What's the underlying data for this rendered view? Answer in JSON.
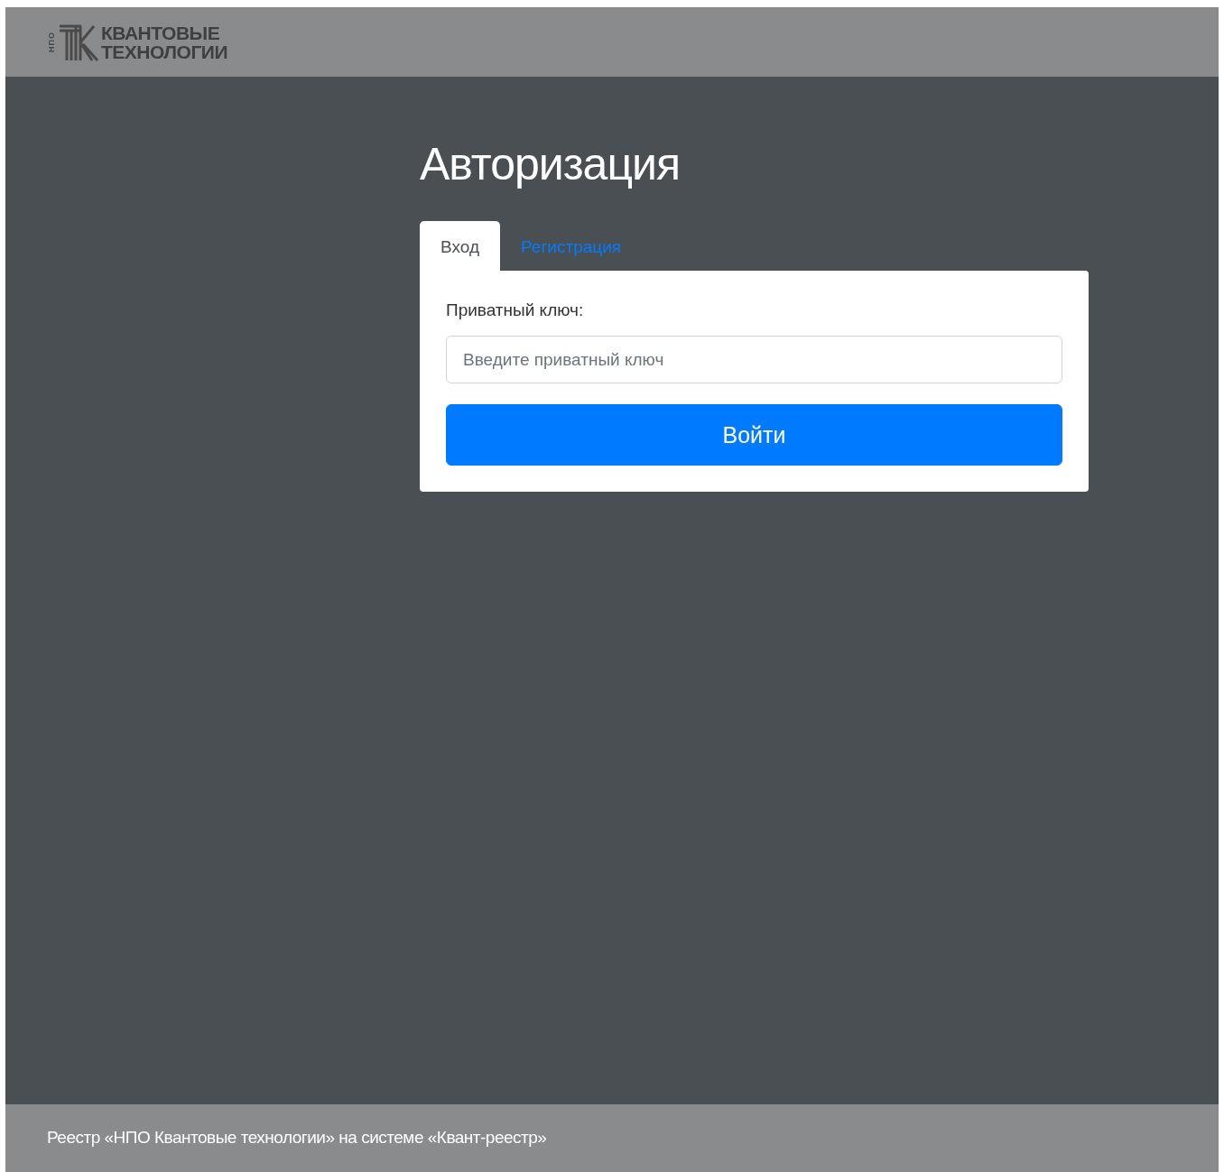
{
  "header": {
    "logo": {
      "side_text": "НПО",
      "lines": [
        "КВАНТОВЫЕ",
        "ТЕХНОЛОГИИ"
      ]
    }
  },
  "title": "Авторизация",
  "tabs": [
    {
      "label": "Вход",
      "selected": true
    },
    {
      "label": "Регистрация",
      "selected": false
    }
  ],
  "form": {
    "label": "Приватный ключ:",
    "placeholder": "Введите приватный ключ",
    "button": "Войти"
  },
  "footer": {
    "text": "Реестр «НПО Квантовые технологии» на системе «Квант-реестр»"
  }
}
